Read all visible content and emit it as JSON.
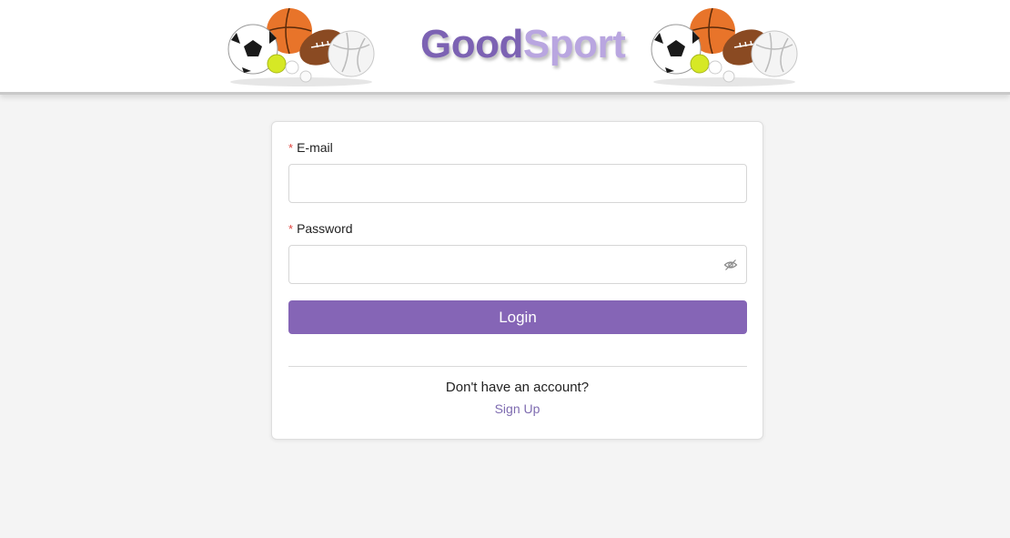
{
  "header": {
    "brand_part1": "Good",
    "brand_part2": "Sport",
    "colors": {
      "good": "#7c62b3",
      "sport": "#b9a6e0"
    },
    "decoration_icons": [
      "sports-balls-icon",
      "sports-balls-icon"
    ]
  },
  "form": {
    "email": {
      "label": "E-mail",
      "required_marker": "*",
      "value": ""
    },
    "password": {
      "label": "Password",
      "required_marker": "*",
      "value": "",
      "toggle_icon": "eye-off-icon"
    },
    "login_label": "Login",
    "no_account_text": "Don't have an account?",
    "signup_label": "Sign Up"
  },
  "colors": {
    "accent": "#8565b6",
    "link": "#7e6bb0",
    "required": "#e0443e"
  }
}
